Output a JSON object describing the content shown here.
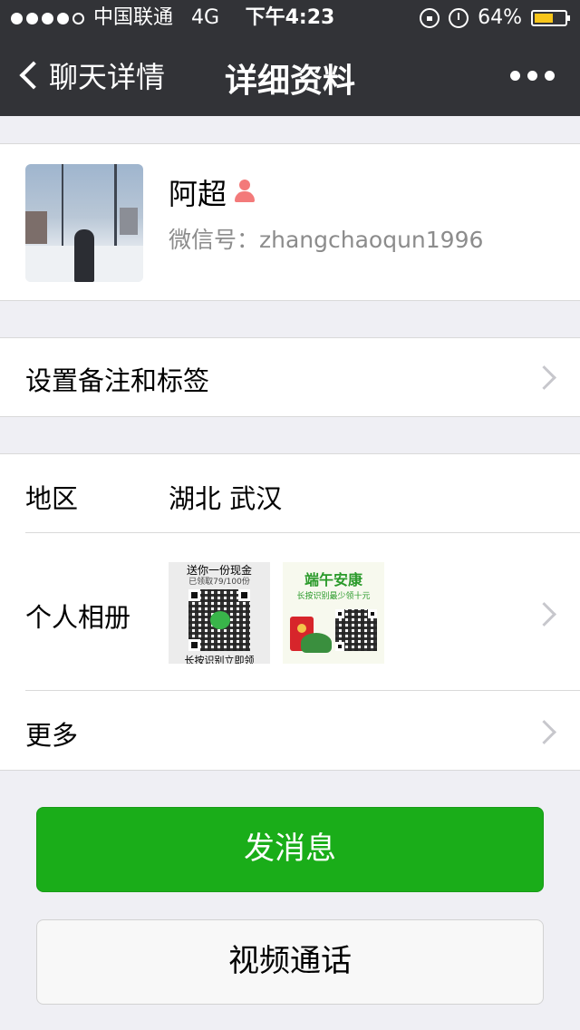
{
  "status_bar": {
    "carrier": "中国联通",
    "network": "4G",
    "time": "下午4:23",
    "battery_percent": "64%",
    "battery_level": 0.64,
    "signal_bars_filled": 4,
    "signal_bars_total": 5,
    "icons": [
      "rotation-lock-icon",
      "alarm-icon",
      "battery-icon"
    ]
  },
  "nav": {
    "back_label": "聊天详情",
    "title": "详细资料",
    "more_icon": "more-dots-icon"
  },
  "profile": {
    "name": "阿超",
    "gender_icon": "female-icon",
    "wechat_id": "微信号：zhangchaoqun1996"
  },
  "remark": {
    "label": "设置备注和标签"
  },
  "details": {
    "region_label": "地区",
    "region_value": "湖北 武汉",
    "album_label": "个人相册",
    "album_thumbs": [
      {
        "title": "送你一份现金",
        "sub": "已领取79/100份",
        "footer": "长按识别立即领"
      },
      {
        "title": "端午安康",
        "sub": "长按识别最少领十元"
      }
    ],
    "more_label": "更多"
  },
  "actions": {
    "send_message": "发消息",
    "video_call": "视频通话"
  },
  "colors": {
    "nav_bg": "#323337",
    "primary_green": "#1aad19",
    "page_bg": "#efeff4",
    "battery": "#f7c51a"
  }
}
